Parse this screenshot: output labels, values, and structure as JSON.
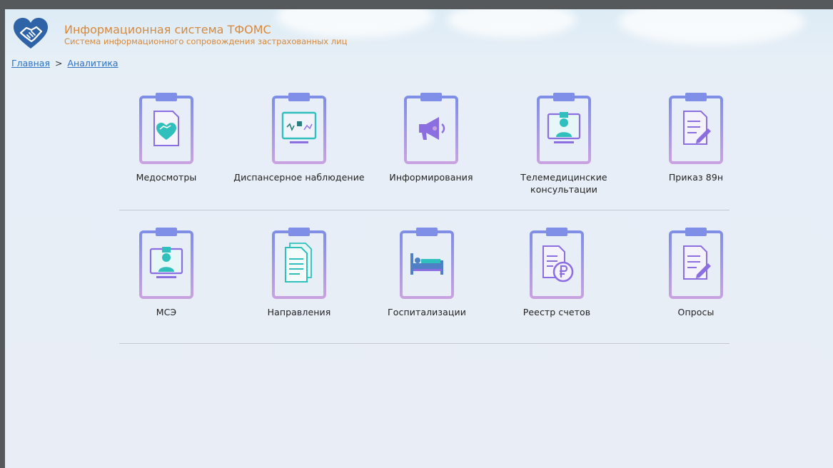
{
  "header": {
    "title": "Информационная система ТФОМС",
    "subtitle": "Система информационного сопровождения застрахованных лиц"
  },
  "breadcrumb": {
    "items": [
      {
        "label": "Главная"
      },
      {
        "label": "Аналитика"
      }
    ],
    "separator": ">"
  },
  "tiles": {
    "row1": [
      {
        "label": "Медосмотры",
        "icon": "heart-handshake-document-icon"
      },
      {
        "label": "Диспансерное наблюдение",
        "icon": "monitor-chart-icon"
      },
      {
        "label": "Информирования",
        "icon": "megaphone-icon"
      },
      {
        "label": "Телемедицинские консультации",
        "icon": "doctor-monitor-icon"
      },
      {
        "label": "Приказ 89н",
        "icon": "document-pen-icon"
      }
    ],
    "row2": [
      {
        "label": "МСЭ",
        "icon": "doctor-monitor-icon"
      },
      {
        "label": "Направления",
        "icon": "documents-stack-icon"
      },
      {
        "label": "Госпитализации",
        "icon": "hospital-bed-icon"
      },
      {
        "label": "Реестр счетов",
        "icon": "ruble-document-icon"
      },
      {
        "label": "Опросы",
        "icon": "document-pen-icon"
      }
    ]
  },
  "colors": {
    "title": "#d8893a",
    "link": "#2d72c5",
    "clipboard_top": "#7f8ee6",
    "clipboard_bottom": "#c8a0e0",
    "icon_teal": "#2fc0bd",
    "icon_purple": "#8b6ee0"
  }
}
